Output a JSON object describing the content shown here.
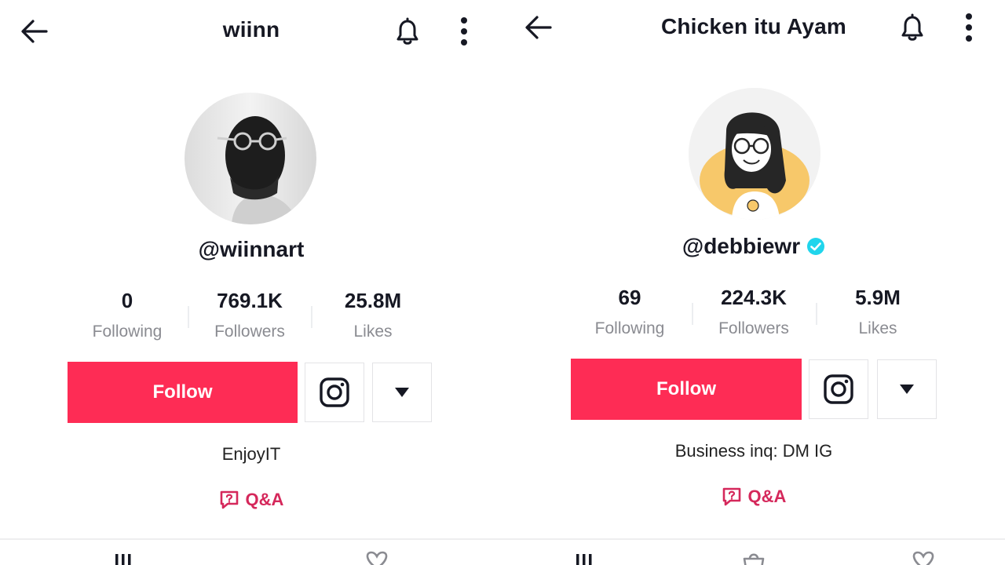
{
  "left": {
    "title": "wiinn",
    "username": "@wiinnart",
    "stats": [
      {
        "value": "0",
        "label": "Following"
      },
      {
        "value": "769.1K",
        "label": "Followers"
      },
      {
        "value": "25.8M",
        "label": "Likes"
      }
    ],
    "follow_label": "Follow",
    "bio": "EnjoyIT",
    "qa_label": "Q&A",
    "icons": [
      "back-arrow-icon",
      "bell-icon",
      "more-vertical-icon",
      "instagram-icon",
      "caret-down-icon",
      "question-bubble-icon",
      "grid-tab-icon",
      "heart-tab-icon"
    ]
  },
  "right": {
    "title": "Chicken itu Ayam",
    "username": "@debbiewr",
    "verified": true,
    "stats": [
      {
        "value": "69",
        "label": "Following"
      },
      {
        "value": "224.3K",
        "label": "Followers"
      },
      {
        "value": "5.9M",
        "label": "Likes"
      }
    ],
    "follow_label": "Follow",
    "bio": "Business inq: DM IG",
    "qa_label": "Q&A",
    "icons": [
      "back-arrow-icon",
      "bell-icon",
      "more-vertical-icon",
      "verified-badge-icon",
      "instagram-icon",
      "caret-down-icon",
      "question-bubble-icon",
      "grid-tab-icon",
      "bag-tab-icon",
      "heart-tab-icon"
    ]
  },
  "colors": {
    "follow_button": "#fe2c55",
    "qa_text": "#d5285b",
    "verified_badge": "#20d5ec",
    "muted_label": "#8a8b91"
  }
}
